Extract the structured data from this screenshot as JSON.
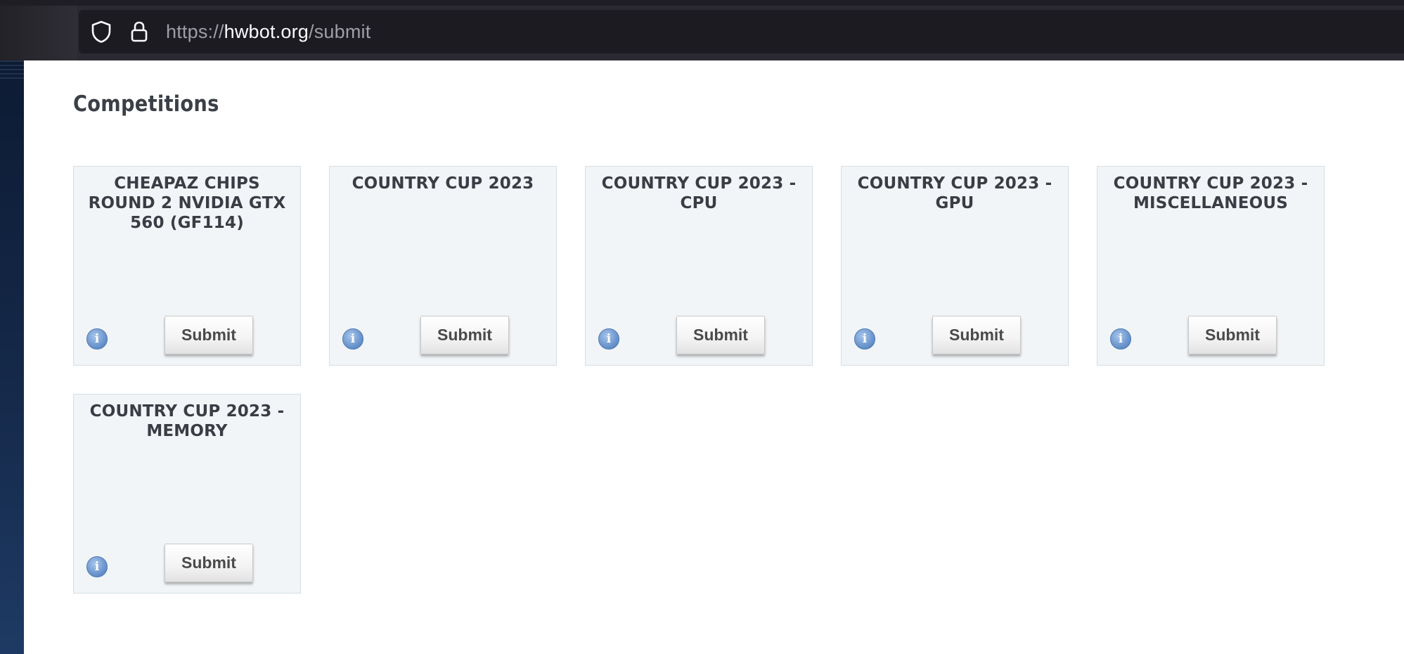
{
  "browser": {
    "url_scheme": "https://",
    "url_host": "hwbot.org",
    "url_path": "/submit",
    "icons": [
      "shield-icon",
      "lock-icon"
    ]
  },
  "page": {
    "title": "Competitions"
  },
  "competitions": [
    {
      "title": "CHEAPAZ CHIPS ROUND 2 NVIDIA GTX 560 (GF114)",
      "button": "Submit",
      "info": "i"
    },
    {
      "title": "COUNTRY CUP 2023",
      "button": "Submit",
      "info": "i"
    },
    {
      "title": "COUNTRY CUP 2023 - CPU",
      "button": "Submit",
      "info": "i"
    },
    {
      "title": "COUNTRY CUP 2023 - GPU",
      "button": "Submit",
      "info": "i"
    },
    {
      "title": "COUNTRY CUP 2023 - MISCELLANEOUS",
      "button": "Submit",
      "info": "i"
    },
    {
      "title": "COUNTRY CUP 2023 - MEMORY",
      "button": "Submit",
      "info": "i"
    }
  ],
  "colors": {
    "card_background": "#f1f5f7",
    "card_border": "#d6dde1",
    "info_icon": "#6f98cf",
    "chrome": "#2b2a33",
    "urlbar": "#1c1b22"
  }
}
